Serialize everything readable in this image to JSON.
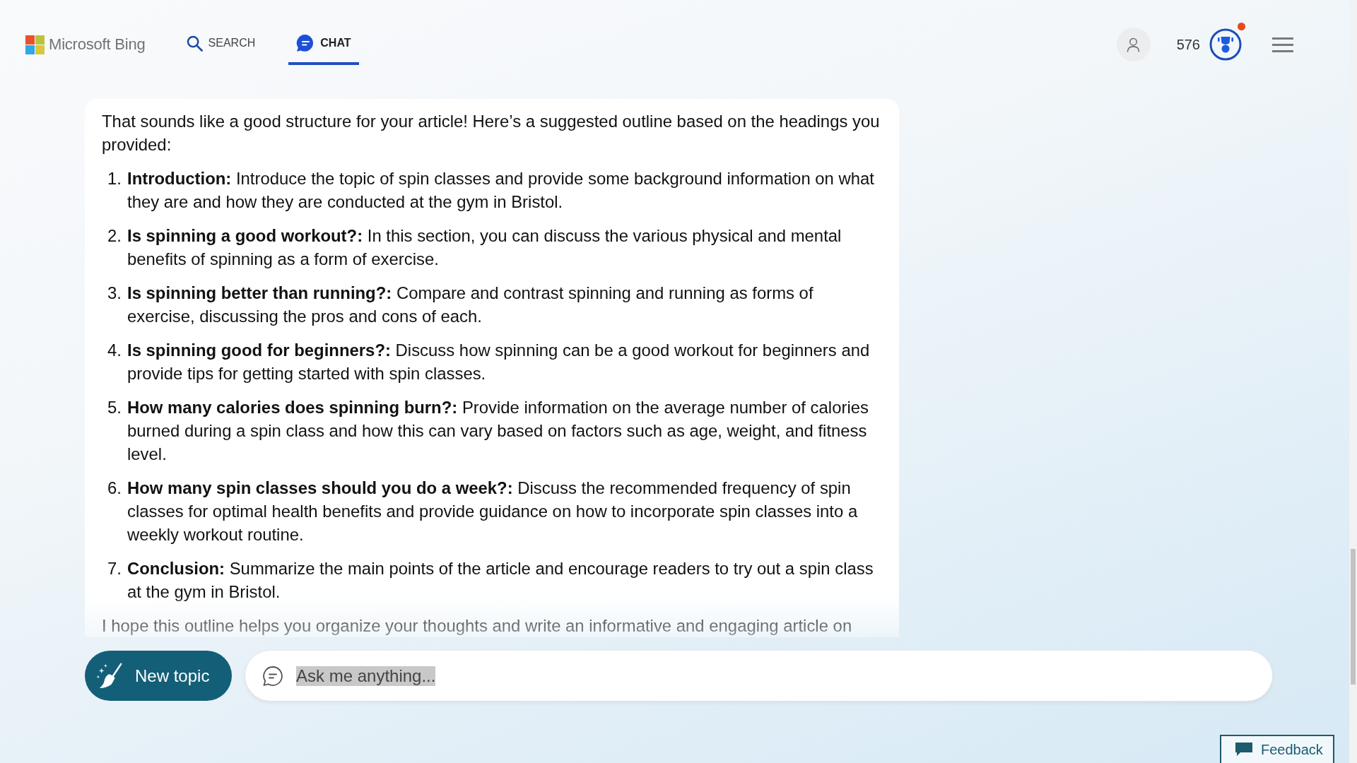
{
  "header": {
    "logo": {
      "text": "Microsoft Bing"
    },
    "tabs": [
      {
        "label": "SEARCH",
        "kind": "search",
        "selected": false
      },
      {
        "label": "CHAT",
        "kind": "chat",
        "selected": true
      }
    ],
    "rewards": {
      "points": "576",
      "notification": true
    }
  },
  "message": {
    "intro": "That sounds like a good structure for your article! Here’s a suggested outline based on the headings you provided:",
    "items": [
      {
        "number": "1.",
        "text": "**Introduction:** Introduce the topic of spin classes and provide some background information on what they are and how they are conducted at the gym in Bristol."
      },
      {
        "number": "2.",
        "text": "**Is spinning a good workout?:** In this section, you can discuss the various physical and mental benefits of spinning as a form of exercise."
      },
      {
        "number": "3.",
        "text": "**Is spinning better than running?:** Compare and contrast spinning and running as forms of exercise, discussing the pros and cons of each."
      },
      {
        "number": "4.",
        "text": "**Is spinning good for beginners?:** Discuss how spinning can be a good workout for beginners and provide tips for getting started with spin classes."
      },
      {
        "number": "5.",
        "text": "**How many calories does spinning burn?:** Provide information on the average number of calories burned during a spin class and how this can vary based on factors such as age, weight, and fitness level."
      },
      {
        "number": "6.",
        "text": "**How many spin classes should you do a week?:** Discuss the recommended frequency of spin classes for optimal health benefits and provide guidance on how to incorporate spin classes into a weekly workout routine."
      },
      {
        "number": "7.",
        "text": "**Conclusion:** Summarize the main points of the article and encourage readers to try out a spin class at the gym in Bristol."
      }
    ],
    "closing": "I hope this outline helps you organize your thoughts and write an informative and engaging article on"
  },
  "composer": {
    "new_topic": "New topic",
    "placeholder": "Ask me anything..."
  },
  "feedback": {
    "label": "Feedback"
  }
}
